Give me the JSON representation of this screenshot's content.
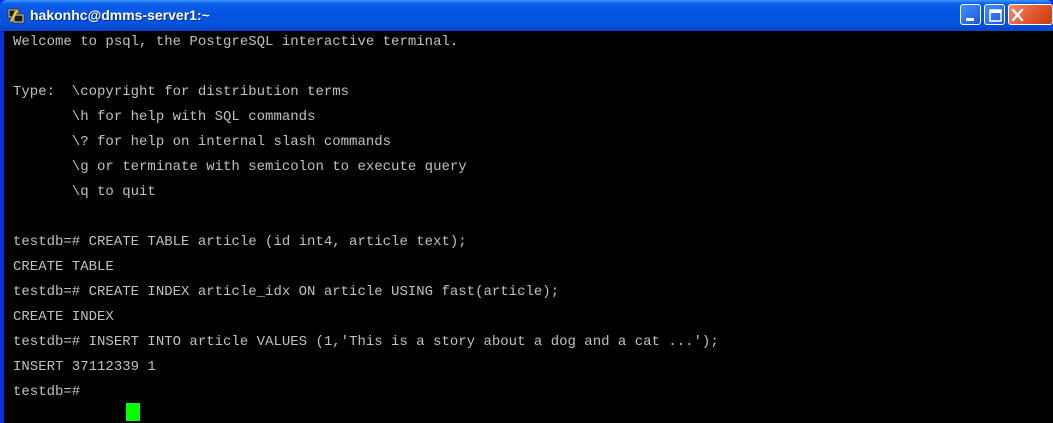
{
  "window": {
    "title": "hakonhc@dmms-server1:~",
    "icon": "putty-terminal-icon"
  },
  "terminal": {
    "lines": [
      "Welcome to psql, the PostgreSQL interactive terminal.",
      "",
      "Type:  \\copyright for distribution terms",
      "       \\h for help with SQL commands",
      "       \\? for help on internal slash commands",
      "       \\g or terminate with semicolon to execute query",
      "       \\q to quit",
      "",
      "testdb=# CREATE TABLE article (id int4, article text);",
      "CREATE TABLE",
      "testdb=# CREATE INDEX article_idx ON article USING fast(article);",
      "CREATE INDEX",
      "testdb=# INSERT INTO article VALUES (1,'This is a story about a dog and a cat ...');",
      "INSERT 37112339 1",
      "testdb=# "
    ],
    "text_color": "#c0c0c0",
    "background": "#000000",
    "cursor_color": "#00ff00"
  }
}
